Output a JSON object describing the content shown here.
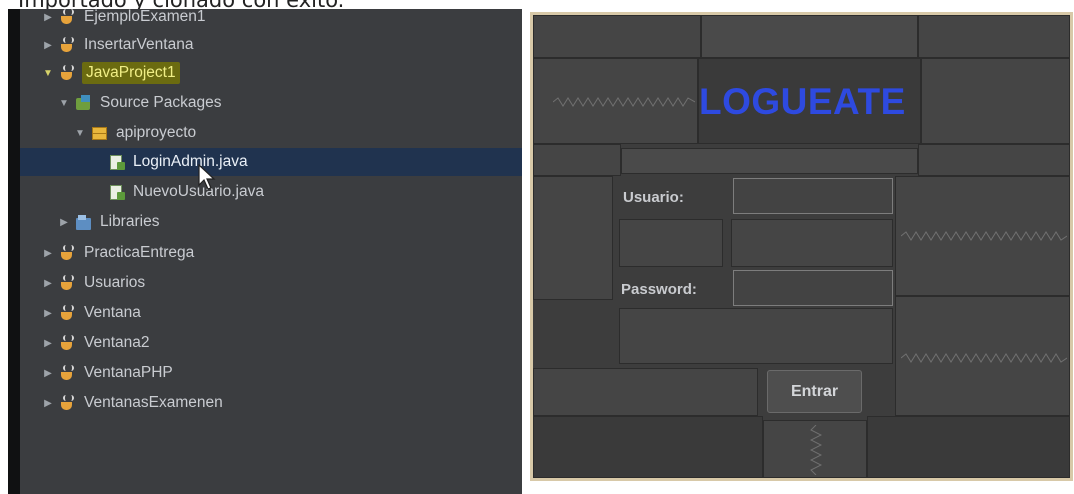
{
  "caption": "Importado y clonado con éxito.",
  "tree": {
    "rows": [
      {
        "label": "EjemploExamen1",
        "icon": "cup-icon",
        "expanded": false
      },
      {
        "label": "InsertarVentana",
        "icon": "cup-icon",
        "expanded": false
      },
      {
        "label": "JavaProject1",
        "icon": "cup-icon",
        "expanded": true,
        "highlight": true
      },
      {
        "label": "Source Packages",
        "icon": "source-packages-icon",
        "expanded": true
      },
      {
        "label": "apiproyecto",
        "icon": "package-icon",
        "expanded": true
      },
      {
        "label": "LoginAdmin.java",
        "icon": "java-file-icon",
        "selected": true
      },
      {
        "label": "NuevoUsuario.java",
        "icon": "java-file-icon"
      },
      {
        "label": "Libraries",
        "icon": "libraries-icon",
        "expanded": false
      },
      {
        "label": "PracticaEntrega",
        "icon": "cup-icon",
        "expanded": false
      },
      {
        "label": "Usuarios",
        "icon": "cup-icon",
        "expanded": false
      },
      {
        "label": "Ventana",
        "icon": "cup-icon",
        "expanded": false
      },
      {
        "label": "Ventana2",
        "icon": "cup-icon",
        "expanded": false
      },
      {
        "label": "VentanaPHP",
        "icon": "cup-icon",
        "expanded": false
      },
      {
        "label": "VentanasExamenen",
        "icon": "cup-icon",
        "expanded": false
      }
    ]
  },
  "form": {
    "title": "LOGUEATE",
    "user_label": "Usuario:",
    "user_value": "",
    "password_label": "Password:",
    "password_value": "",
    "enter_label": "Entrar"
  },
  "colors": {
    "tree_bg": "#3b3d40",
    "selection": "#20334f",
    "highlight": "#6b6b10",
    "title": "#2e4ae0",
    "form_border": "#d8c9a8"
  }
}
